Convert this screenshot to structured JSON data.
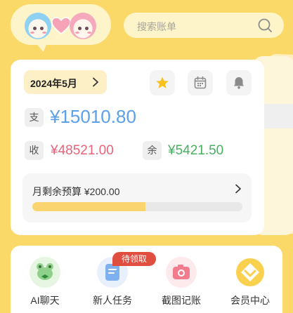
{
  "header": {
    "search_placeholder": "搜索账单"
  },
  "summary": {
    "month": "2024年5月",
    "expense_tag": "支",
    "expense_amount": "¥15010.80",
    "income_tag": "收",
    "income_amount": "¥48521.00",
    "balance_tag": "余",
    "balance_amount": "¥5421.50",
    "budget_label": "月剩余预算 ¥200.00",
    "budget_progress_fraction": 0.54
  },
  "quick_actions": [
    {
      "label": "AI聊天",
      "icon": "frog-chat-icon"
    },
    {
      "label": "新人任务",
      "icon": "task-note-icon",
      "badge": "待领取"
    },
    {
      "label": "截图记账",
      "icon": "camera-icon"
    },
    {
      "label": "会员中心",
      "icon": "diamond-vip-icon"
    }
  ],
  "colors": {
    "background": "#FBD968",
    "expense": "#5BA0E8",
    "income": "#E8637A",
    "balance": "#47B060",
    "badge": "#E04E40",
    "budget_fill": "#FAD46E"
  }
}
